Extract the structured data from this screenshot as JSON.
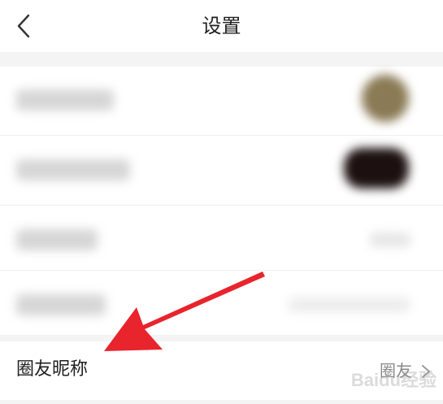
{
  "header": {
    "title": "设置",
    "back_icon": "chevron-left-icon"
  },
  "settings": {
    "nickname_row": {
      "label": "圈友昵称",
      "value": "圈友",
      "chevron_icon": "chevron-right-icon"
    }
  },
  "annotation": {
    "arrow_color": "#e8242c",
    "pointer_icon": "red-arrow-icon"
  },
  "watermark": {
    "text": "Baidu经验"
  }
}
